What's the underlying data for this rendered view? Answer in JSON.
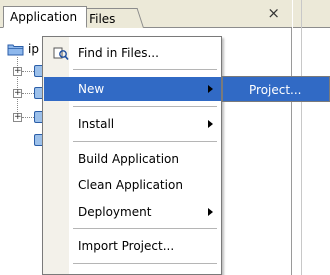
{
  "tabs": {
    "application": "Application",
    "files": "Files",
    "close": "×"
  },
  "tree": {
    "root_label": "ip"
  },
  "menu": {
    "items": [
      {
        "label": "Find in Files..."
      },
      {
        "label": "New"
      },
      {
        "label": "Install"
      },
      {
        "label": "Build Application"
      },
      {
        "label": "Clean Application"
      },
      {
        "label": "Deployment"
      },
      {
        "label": "Import Project..."
      }
    ]
  },
  "submenu": {
    "items": [
      {
        "label": "Project..."
      }
    ]
  },
  "colors": {
    "highlight": "#316ac5",
    "chrome": "#ece9d8"
  }
}
